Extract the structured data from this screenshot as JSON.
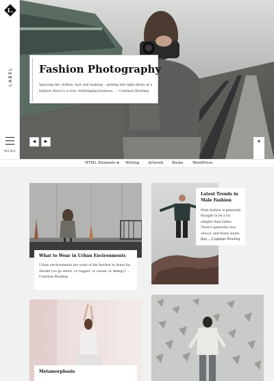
{
  "site": {
    "logo_letter": "L.",
    "label": "LABEL",
    "menu_label": "MENU"
  },
  "hero": {
    "title": "Fashion Photography",
    "excerpt": "Ignoring the clothes, hair and makeup – getting the right photo at a fashion shoot is a very challenging business. …",
    "read_more": "Continue Reading",
    "prev_arrow": "◀",
    "next_arrow": "▶",
    "scroll_icon": "▼"
  },
  "nav": {
    "items": [
      "HTML Elements",
      "Writing",
      "Artwork",
      "Books",
      "WordPress"
    ],
    "caret": "▼"
  },
  "posts": [
    {
      "title": "What to Wear in Urban Environments",
      "excerpt": "Urban environments are some of the hardest to dress for. Should you go smart, or rugged, or casual, or skimpy? …",
      "read_more": "Continue Reading"
    },
    {
      "title": "Latest Trends in Male Fashion",
      "excerpt": "Male fashion is generally thought to be a lot simpler than ladies. There's generally less choice, and fewer styles. But …",
      "read_more": "Continue Reading",
      "date": "JULY 10, 2016"
    },
    {
      "title": "Metamorphosis"
    }
  ],
  "colors": {
    "page_bg": "#f1f1f1",
    "card_bg": "#ffffff",
    "text": "#111111"
  }
}
